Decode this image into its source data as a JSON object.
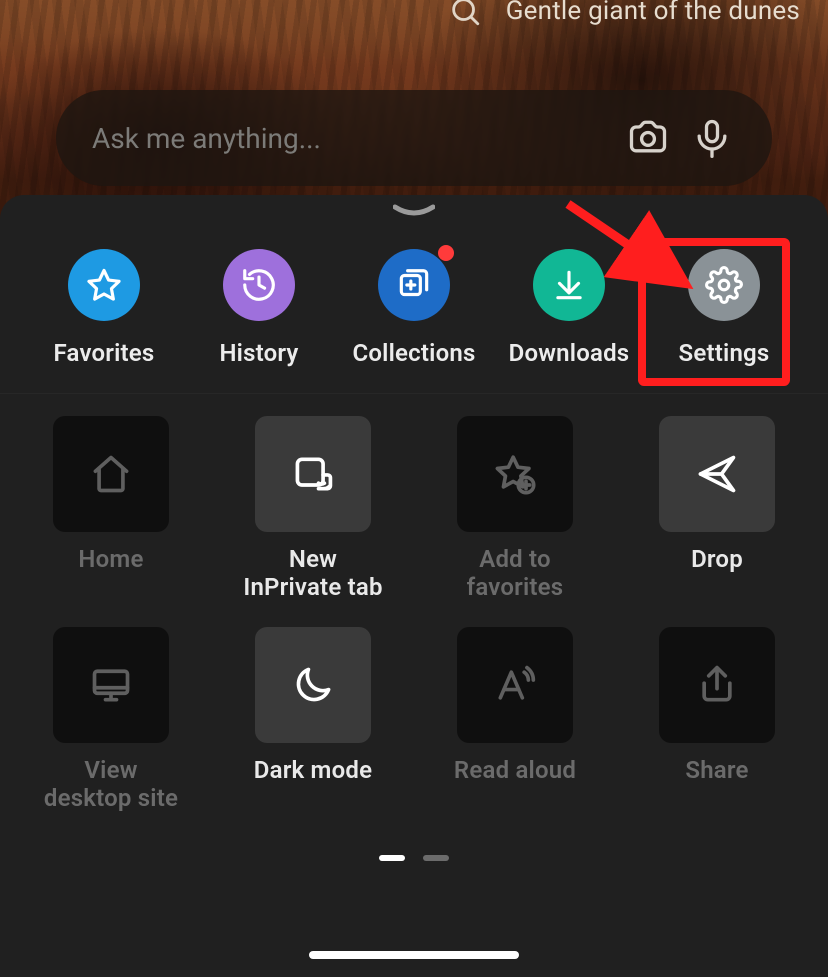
{
  "header": {
    "query": "Gentle giant of the dunes"
  },
  "ask": {
    "placeholder": "Ask me anything..."
  },
  "primary_row": [
    {
      "key": "favorites",
      "label": "Favorites",
      "circle_class": "c-favorites"
    },
    {
      "key": "history",
      "label": "History",
      "circle_class": "c-history"
    },
    {
      "key": "collections",
      "label": "Collections",
      "circle_class": "c-collections",
      "has_badge": true
    },
    {
      "key": "downloads",
      "label": "Downloads",
      "circle_class": "c-downloads"
    },
    {
      "key": "settings",
      "label": "Settings",
      "circle_class": "c-settings"
    }
  ],
  "tiles": [
    {
      "key": "home",
      "label": "Home",
      "square": "dark",
      "icon_class": "icn-dim",
      "label_class": "lbl-dim"
    },
    {
      "key": "inprivate",
      "label": "New InPrivate tab",
      "square": "light",
      "icon_class": "icn-bright",
      "label_class": "lbl-bright"
    },
    {
      "key": "add_favorites",
      "label": "Add to favorites",
      "square": "dark",
      "icon_class": "icn-dim",
      "label_class": "lbl-dim"
    },
    {
      "key": "drop",
      "label": "Drop",
      "square": "light",
      "icon_class": "icn-bright",
      "label_class": "lbl-bright"
    },
    {
      "key": "view_desktop",
      "label": "View desktop site",
      "square": "dark",
      "icon_class": "icn-dim",
      "label_class": "lbl-dim"
    },
    {
      "key": "dark_mode",
      "label": "Dark mode",
      "square": "light",
      "icon_class": "icn-bright",
      "label_class": "lbl-bright"
    },
    {
      "key": "read_aloud",
      "label": "Read aloud",
      "square": "dark",
      "icon_class": "icn-dim",
      "label_class": "lbl-dim"
    },
    {
      "key": "share",
      "label": "Share",
      "square": "dark",
      "icon_class": "icn-dim",
      "label_class": "lbl-dim"
    }
  ],
  "pager": {
    "active_index": 0,
    "count": 2
  }
}
